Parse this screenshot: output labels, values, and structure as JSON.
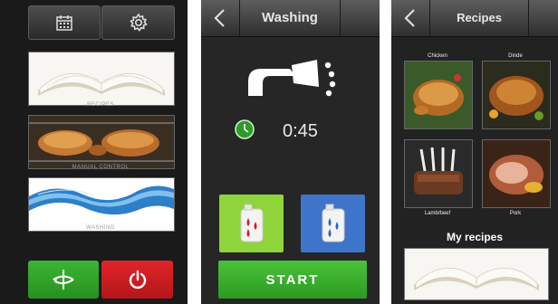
{
  "home": {
    "calendar_icon": "calendar-icon",
    "settings_icon": "gear-icon",
    "tiles": [
      {
        "label": "RECIPES",
        "icon": "open-book-image"
      },
      {
        "label": "MANUAL CONTROL",
        "icon": "roast-chicken-image"
      },
      {
        "label": "WASHING",
        "icon": "water-wave-image"
      }
    ],
    "rotate_icon": "rotate-icon",
    "power_icon": "power-icon",
    "colors": {
      "green": "#2f9e27",
      "red": "#d31f24"
    }
  },
  "washing": {
    "title": "Washing",
    "timer": "0:45",
    "start_label": "START",
    "colors": {
      "red_can": "#8fd43a",
      "blue_can": "#3e74c9",
      "start": "#3aad2f"
    }
  },
  "recipes": {
    "title": "Recipes",
    "items": [
      {
        "label": "Chicken"
      },
      {
        "label": "Dinde"
      },
      {
        "label": "Lamb/beef"
      },
      {
        "label": "Pork"
      }
    ],
    "my_recipes_label": "My recipes"
  }
}
